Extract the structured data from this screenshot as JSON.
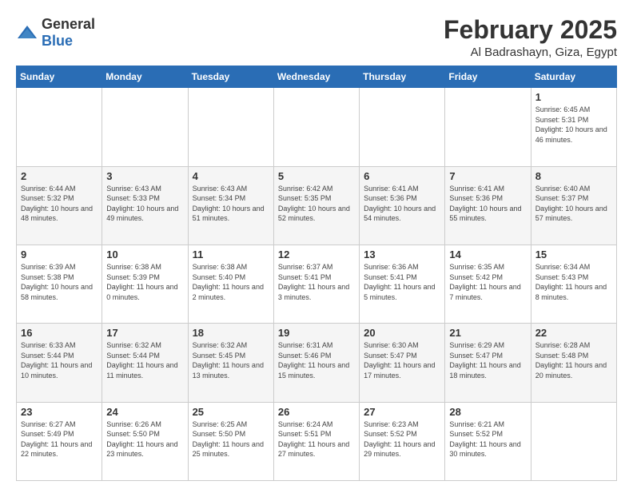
{
  "logo": {
    "general": "General",
    "blue": "Blue"
  },
  "header": {
    "title": "February 2025",
    "location": "Al Badrashayn, Giza, Egypt"
  },
  "weekdays": [
    "Sunday",
    "Monday",
    "Tuesday",
    "Wednesday",
    "Thursday",
    "Friday",
    "Saturday"
  ],
  "weeks": [
    [
      {
        "day": "",
        "info": ""
      },
      {
        "day": "",
        "info": ""
      },
      {
        "day": "",
        "info": ""
      },
      {
        "day": "",
        "info": ""
      },
      {
        "day": "",
        "info": ""
      },
      {
        "day": "",
        "info": ""
      },
      {
        "day": "1",
        "info": "Sunrise: 6:45 AM\nSunset: 5:31 PM\nDaylight: 10 hours\nand 46 minutes."
      }
    ],
    [
      {
        "day": "2",
        "info": "Sunrise: 6:44 AM\nSunset: 5:32 PM\nDaylight: 10 hours\nand 48 minutes."
      },
      {
        "day": "3",
        "info": "Sunrise: 6:43 AM\nSunset: 5:33 PM\nDaylight: 10 hours\nand 49 minutes."
      },
      {
        "day": "4",
        "info": "Sunrise: 6:43 AM\nSunset: 5:34 PM\nDaylight: 10 hours\nand 51 minutes."
      },
      {
        "day": "5",
        "info": "Sunrise: 6:42 AM\nSunset: 5:35 PM\nDaylight: 10 hours\nand 52 minutes."
      },
      {
        "day": "6",
        "info": "Sunrise: 6:41 AM\nSunset: 5:36 PM\nDaylight: 10 hours\nand 54 minutes."
      },
      {
        "day": "7",
        "info": "Sunrise: 6:41 AM\nSunset: 5:36 PM\nDaylight: 10 hours\nand 55 minutes."
      },
      {
        "day": "8",
        "info": "Sunrise: 6:40 AM\nSunset: 5:37 PM\nDaylight: 10 hours\nand 57 minutes."
      }
    ],
    [
      {
        "day": "9",
        "info": "Sunrise: 6:39 AM\nSunset: 5:38 PM\nDaylight: 10 hours\nand 58 minutes."
      },
      {
        "day": "10",
        "info": "Sunrise: 6:38 AM\nSunset: 5:39 PM\nDaylight: 11 hours\nand 0 minutes."
      },
      {
        "day": "11",
        "info": "Sunrise: 6:38 AM\nSunset: 5:40 PM\nDaylight: 11 hours\nand 2 minutes."
      },
      {
        "day": "12",
        "info": "Sunrise: 6:37 AM\nSunset: 5:41 PM\nDaylight: 11 hours\nand 3 minutes."
      },
      {
        "day": "13",
        "info": "Sunrise: 6:36 AM\nSunset: 5:41 PM\nDaylight: 11 hours\nand 5 minutes."
      },
      {
        "day": "14",
        "info": "Sunrise: 6:35 AM\nSunset: 5:42 PM\nDaylight: 11 hours\nand 7 minutes."
      },
      {
        "day": "15",
        "info": "Sunrise: 6:34 AM\nSunset: 5:43 PM\nDaylight: 11 hours\nand 8 minutes."
      }
    ],
    [
      {
        "day": "16",
        "info": "Sunrise: 6:33 AM\nSunset: 5:44 PM\nDaylight: 11 hours\nand 10 minutes."
      },
      {
        "day": "17",
        "info": "Sunrise: 6:32 AM\nSunset: 5:44 PM\nDaylight: 11 hours\nand 11 minutes."
      },
      {
        "day": "18",
        "info": "Sunrise: 6:32 AM\nSunset: 5:45 PM\nDaylight: 11 hours\nand 13 minutes."
      },
      {
        "day": "19",
        "info": "Sunrise: 6:31 AM\nSunset: 5:46 PM\nDaylight: 11 hours\nand 15 minutes."
      },
      {
        "day": "20",
        "info": "Sunrise: 6:30 AM\nSunset: 5:47 PM\nDaylight: 11 hours\nand 17 minutes."
      },
      {
        "day": "21",
        "info": "Sunrise: 6:29 AM\nSunset: 5:47 PM\nDaylight: 11 hours\nand 18 minutes."
      },
      {
        "day": "22",
        "info": "Sunrise: 6:28 AM\nSunset: 5:48 PM\nDaylight: 11 hours\nand 20 minutes."
      }
    ],
    [
      {
        "day": "23",
        "info": "Sunrise: 6:27 AM\nSunset: 5:49 PM\nDaylight: 11 hours\nand 22 minutes."
      },
      {
        "day": "24",
        "info": "Sunrise: 6:26 AM\nSunset: 5:50 PM\nDaylight: 11 hours\nand 23 minutes."
      },
      {
        "day": "25",
        "info": "Sunrise: 6:25 AM\nSunset: 5:50 PM\nDaylight: 11 hours\nand 25 minutes."
      },
      {
        "day": "26",
        "info": "Sunrise: 6:24 AM\nSunset: 5:51 PM\nDaylight: 11 hours\nand 27 minutes."
      },
      {
        "day": "27",
        "info": "Sunrise: 6:23 AM\nSunset: 5:52 PM\nDaylight: 11 hours\nand 29 minutes."
      },
      {
        "day": "28",
        "info": "Sunrise: 6:21 AM\nSunset: 5:52 PM\nDaylight: 11 hours\nand 30 minutes."
      },
      {
        "day": "",
        "info": ""
      }
    ]
  ]
}
